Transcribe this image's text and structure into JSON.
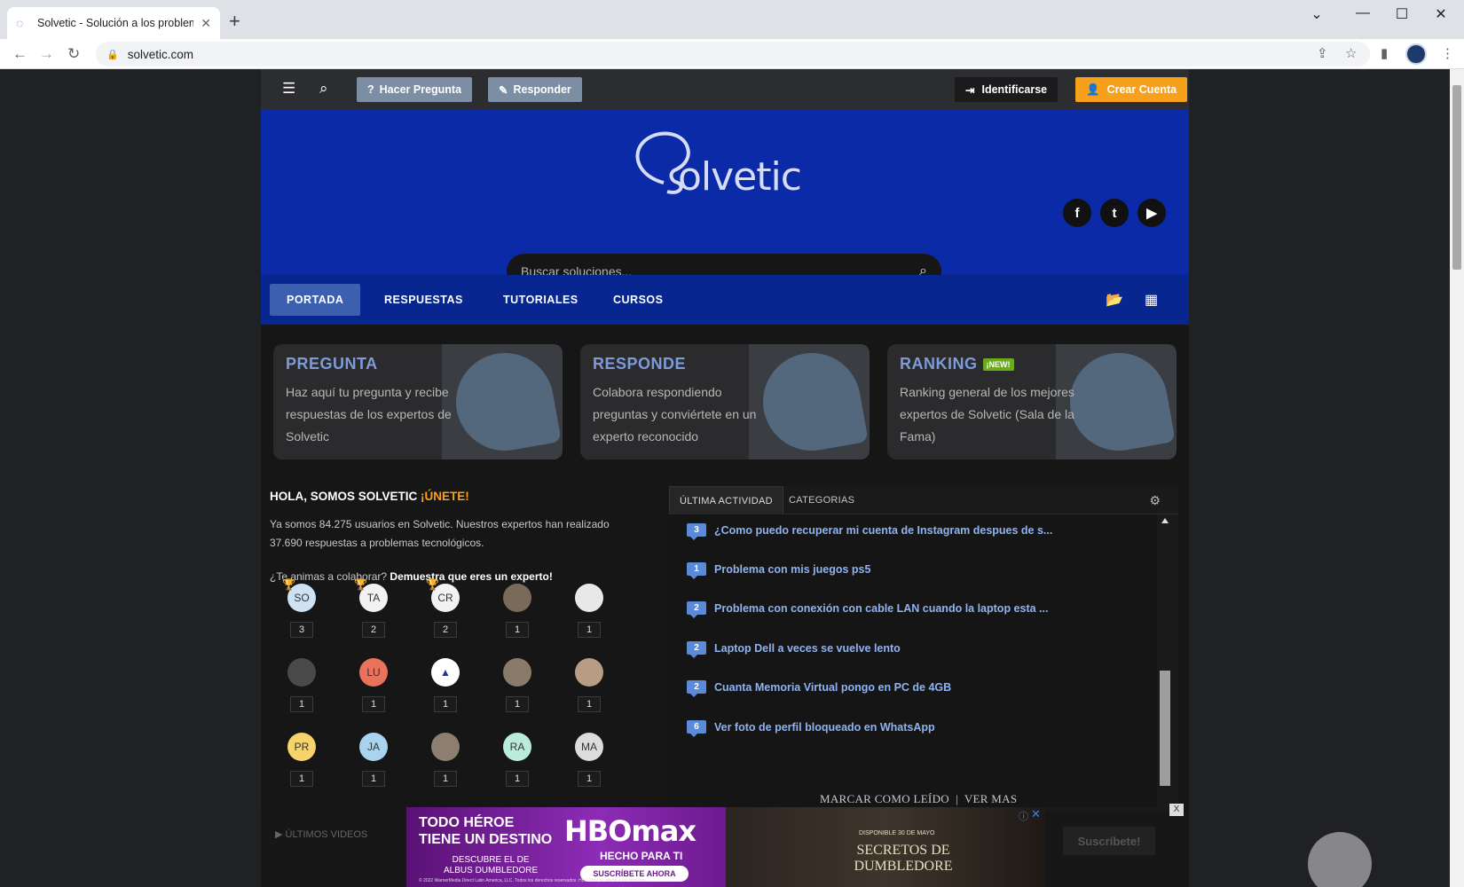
{
  "browser": {
    "tab_title": "Solvetic - Solución a los problem",
    "url": "solvetic.com"
  },
  "topbar": {
    "ask_label": "Hacer Pregunta",
    "answer_label": "Responder",
    "login_label": "Identificarse",
    "register_label": "Crear Cuenta"
  },
  "hero": {
    "logo_text": "olvetic",
    "search_placeholder": "Buscar soluciones..."
  },
  "nav": {
    "items": [
      "PORTADA",
      "RESPUESTAS",
      "TUTORIALES",
      "CURSOS"
    ]
  },
  "cards": [
    {
      "title": "PREGUNTA",
      "text": "Haz aquí tu pregunta y recibe respuestas de los expertos de Solvetic"
    },
    {
      "title": "RESPONDE",
      "text": "Colabora respondiendo preguntas y conviértete en un experto reconocido"
    },
    {
      "title": "RANKING",
      "badge": "¡NEW!",
      "text": "Ranking general de los mejores expertos de Solvetic (Sala de la Fama)"
    }
  ],
  "intro": {
    "heading": "HOLA, SOMOS SOLVETIC",
    "heading_highlight": "¡ÚNETE!",
    "paragraph": "Ya somos 84.275 usuarios en Solvetic. Nuestros expertos han realizado 37.690 respuestas a problemas tecnológicos.",
    "question": "¿Te animas a colaborar?",
    "question_bold": "Demuestra que eres un experto!"
  },
  "users": [
    {
      "initials": "SO",
      "count": "3",
      "color": "#cfe2f3"
    },
    {
      "initials": "TA",
      "count": "2",
      "color": "#f2f2f2"
    },
    {
      "initials": "CR",
      "count": "2",
      "color": "#f2f2f2"
    },
    {
      "initials": "",
      "count": "1",
      "color": "#7a6a5a"
    },
    {
      "initials": "",
      "count": "1",
      "color": "#e8e8e8"
    },
    {
      "initials": "",
      "count": "1",
      "color": "#4a4a4a"
    },
    {
      "initials": "LU",
      "count": "1",
      "color": "#e8735a"
    },
    {
      "initials": "",
      "count": "1",
      "color": "#ffffff"
    },
    {
      "initials": "",
      "count": "1",
      "color": "#8a7a6a"
    },
    {
      "initials": "",
      "count": "1",
      "color": "#b89c84"
    },
    {
      "initials": "PR",
      "count": "1",
      "color": "#f7d36b"
    },
    {
      "initials": "JA",
      "count": "1",
      "color": "#a9d4f0"
    },
    {
      "initials": "",
      "count": "1",
      "color": "#8c7f70"
    },
    {
      "initials": "RA",
      "count": "1",
      "color": "#b9ecd9"
    },
    {
      "initials": "MA",
      "count": "1",
      "color": "#dcdcdc"
    }
  ],
  "activity": {
    "tab_active": "ÚLTIMA ACTIVIDAD",
    "tab_other": "CATEGORIAS",
    "items": [
      {
        "count": "3",
        "title": "¿Como puedo recuperar mi cuenta de Instagram despues de s..."
      },
      {
        "count": "1",
        "title": "Problema con mis juegos ps5"
      },
      {
        "count": "2",
        "title": "Problema con conexión con cable LAN cuando la laptop esta ..."
      },
      {
        "count": "2",
        "title": "Laptop Dell a veces se vuelve lento"
      },
      {
        "count": "2",
        "title": "Cuanta Memoria Virtual pongo en PC de 4GB"
      },
      {
        "count": "6",
        "title": "Ver foto de perfil bloqueado en WhatsApp"
      }
    ],
    "mark_read": "MARCAR COMO LEÍDO",
    "separator": "|",
    "see_more": "VER MAS"
  },
  "below": {
    "videos_label": "ÚLTIMOS VIDEOS",
    "subscribe_label": "Suscríbete!"
  },
  "ad": {
    "line1": "TODO HÉROE",
    "line2": "TIENE UN DESTINO",
    "sub1": "DESCUBRE EL DE",
    "sub2": "ALBUS DUMBLEDORE",
    "brand": "HBOmax",
    "tagline": "HECHO PARA TI",
    "cta": "SUSCRÍBETE AHORA",
    "fine": "© 2022 WarnerMedia Direct Latin America, LLC. Todos los derechos reservados. HBO Max se atiene a los términos.",
    "release": "DISPONIBLE 30 DE MAYO",
    "movie": "SECRETOS DE DUMBLEDORE",
    "close": "X"
  }
}
